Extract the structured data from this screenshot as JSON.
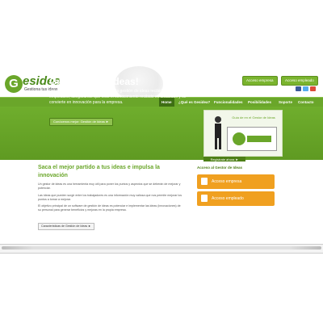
{
  "logo": {
    "letter": "G",
    "word": "esidea",
    "tagline": "Gestiona tus ideas"
  },
  "header": {
    "btn_companies": "Acceso empresa",
    "btn_employees": "Acceso empleado"
  },
  "nav": {
    "items": [
      {
        "label": "Home"
      },
      {
        "label": "¿Qué es Gesidea?"
      },
      {
        "label": "Funcionalidades"
      },
      {
        "label": "Posibilidades"
      },
      {
        "label": "Soporte"
      },
      {
        "label": "Contacto"
      }
    ]
  },
  "hero": {
    "title": "Gestiona tus ideas!",
    "text": "Esta herramienta facilita el análisis y la gestión de ideas recibidas de tus empleados, asegurando que todo el conocimiento recibido es analizado y se convierte en innovación para la empresa.",
    "cta": "Conócenos mejor: Gestión de Ideas ►",
    "video_caption": "Guía de en el Gestor de Ideas",
    "register": "Regístrate ahora ►"
  },
  "content": {
    "title": "Saca el mejor partido a tus ideas e impulsa la innovación",
    "para1": "Un gestor de ideas es una herramienta muy útil para poner los puntos y aspectos que se deberán de mejorar y potenciar.",
    "para2": "Las ideas que pueden surgir entre los trabajadores es una información muy valiosa que nos permite mejorar los puntos a tomar a mejorar.",
    "para3": "El objetivo principal de un software de gestión de ideas es potenciar e implementar las ideas (innovaciones) de su personal para generar beneficios y mejoras en la propia empresa.",
    "link": "Características de Gestión de Ideas ►"
  },
  "sidebar": {
    "title": "Acceso al Gestor de Ideas",
    "card1": "Acceso empresa",
    "card2": "Acceso empleado"
  },
  "colors": {
    "brand_green": "#6aa62a",
    "dark_green": "#4d7f17",
    "card_orange": "#f0a020"
  }
}
